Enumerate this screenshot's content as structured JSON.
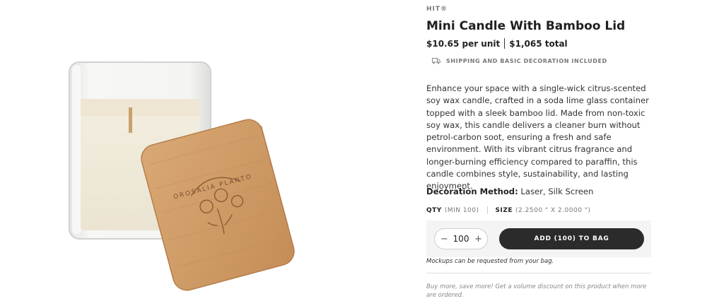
{
  "product": {
    "brand": "HIT®",
    "title": "Mini Candle With Bamboo Lid",
    "price_per_unit": "$10.65 per unit",
    "price_total": "$1,065 total",
    "shipping_note": "SHIPPING AND BASIC DECORATION INCLUDED",
    "description": "Enhance your space with a single-wick citrus-scented soy wax candle, crafted in a soda lime glass container topped with a sleek bamboo lid. Made from non-toxic soy wax, this candle delivers a cleaner burn without petrol-carbon soot, ensuring a fresh and safe environment. With its vibrant citrus fragrance and longer-burning efficiency compared to paraffin, this candle combines style, sustainability, and lasting enjoyment.",
    "decoration_label": "Decoration Method:",
    "decoration_value": "Laser, Silk Screen",
    "lid_engraving": "OROSALIA PLANTO"
  },
  "options": {
    "qty_label": "QTY",
    "qty_min": "(MIN 100)",
    "size_label": "SIZE",
    "size_value": "(2.2500 \" X 2.0000 \")"
  },
  "cart": {
    "quantity": "100",
    "minus": "−",
    "plus": "+",
    "add_button": "ADD (100) TO BAG"
  },
  "notes": {
    "mockup": "Mockups can be requested from your bag.",
    "volume": "Buy more, save more! Get a volume discount on this product when more are ordered."
  },
  "icons": {
    "shipping": "truck-icon"
  }
}
